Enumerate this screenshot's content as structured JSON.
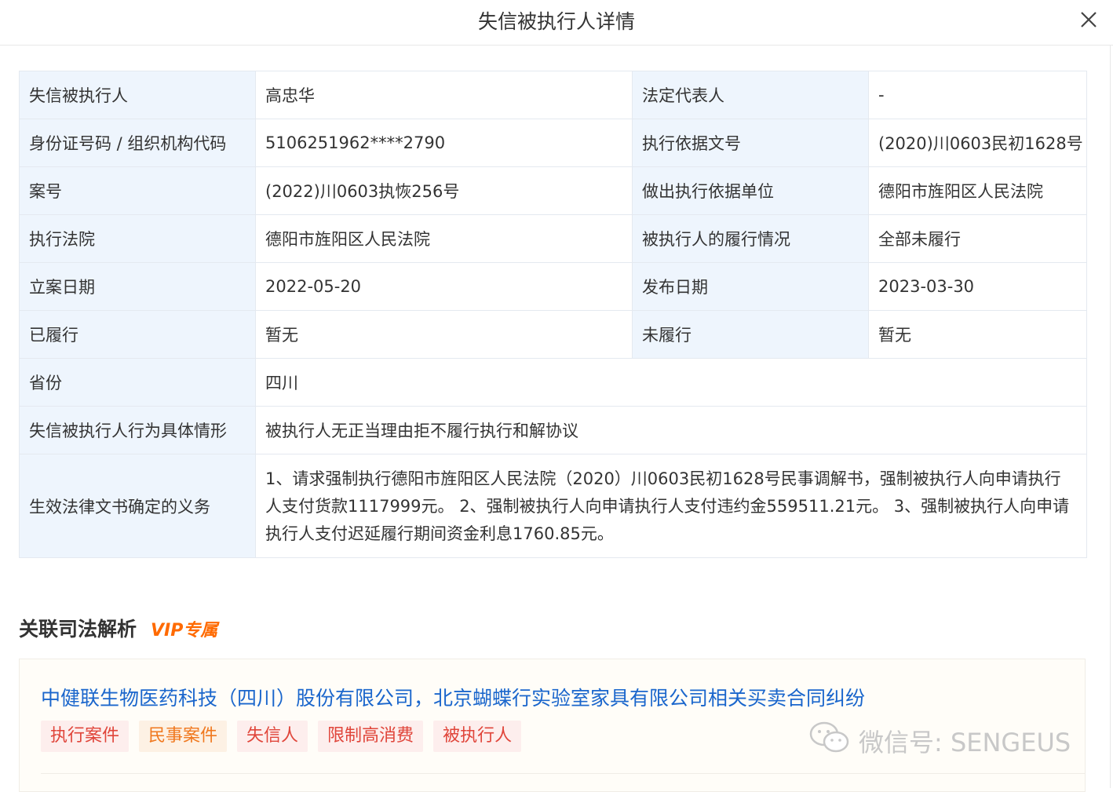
{
  "header": {
    "title": "失信被执行人详情",
    "close_icon": "close-icon"
  },
  "detail": {
    "rows": [
      [
        {
          "label": "失信被执行人",
          "value": "高忠华"
        },
        {
          "label": "法定代表人",
          "value": "-"
        }
      ],
      [
        {
          "label": "身份证号码 / 组织机构代码",
          "value": "5106251962****2790"
        },
        {
          "label": "执行依据文号",
          "value": "(2020)川0603民初1628号"
        }
      ],
      [
        {
          "label": "案号",
          "value": "(2022)川0603执恢256号"
        },
        {
          "label": "做出执行依据单位",
          "value": "德阳市旌阳区人民法院"
        }
      ],
      [
        {
          "label": "执行法院",
          "value": "德阳市旌阳区人民法院"
        },
        {
          "label": "被执行人的履行情况",
          "value": "全部未履行"
        }
      ],
      [
        {
          "label": "立案日期",
          "value": "2022-05-20"
        },
        {
          "label": "发布日期",
          "value": "2023-03-30"
        }
      ],
      [
        {
          "label": "已履行",
          "value": "暂无"
        },
        {
          "label": "未履行",
          "value": "暂无"
        }
      ]
    ],
    "province": {
      "label": "省份",
      "value": "四川"
    },
    "behavior": {
      "label": "失信被执行人行为具体情形",
      "value": "被执行人无正当理由拒不履行执行和解协议"
    },
    "obligation": {
      "label": "生效法律文书确定的义务",
      "value": "1、请求强制执行德阳市旌阳区人民法院（2020）川0603民初1628号民事调解书，强制被执行人向申请执行人支付货款1117999元。 2、强制被执行人向申请执行人支付违约金559511.21元。 3、强制被执行人向申请执行人支付迟延履行期间资金利息1760.85元。"
    }
  },
  "related": {
    "title": "关联司法解析",
    "vip": "VIP专属",
    "case": {
      "title": "中健联生物医药科技（四川）股份有限公司，北京蝴蝶行实验室家具有限公司相关买卖合同纠纷",
      "tags": [
        "执行案件",
        "民事案件",
        "失信人",
        "限制高消费",
        "被执行人"
      ]
    }
  },
  "watermark": {
    "text": "微信号: SENGEUS",
    "icon": "wechat-icon"
  }
}
